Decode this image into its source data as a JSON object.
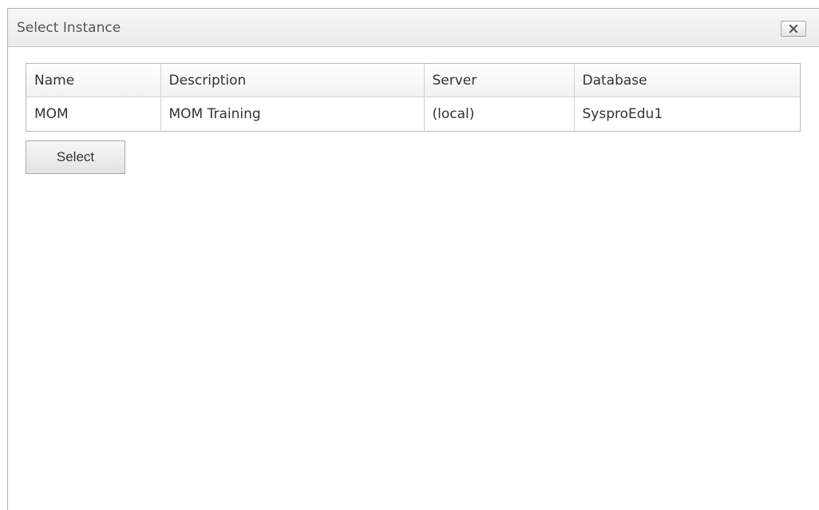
{
  "dialog": {
    "title": "Select Instance",
    "close_icon": "close-icon"
  },
  "grid": {
    "columns": [
      "Name",
      "Description",
      "Server",
      "Database"
    ],
    "rows": [
      [
        "MOM",
        "MOM Training",
        "(local)",
        "SysproEdu1"
      ]
    ]
  },
  "actions": {
    "select_label": "Select"
  }
}
